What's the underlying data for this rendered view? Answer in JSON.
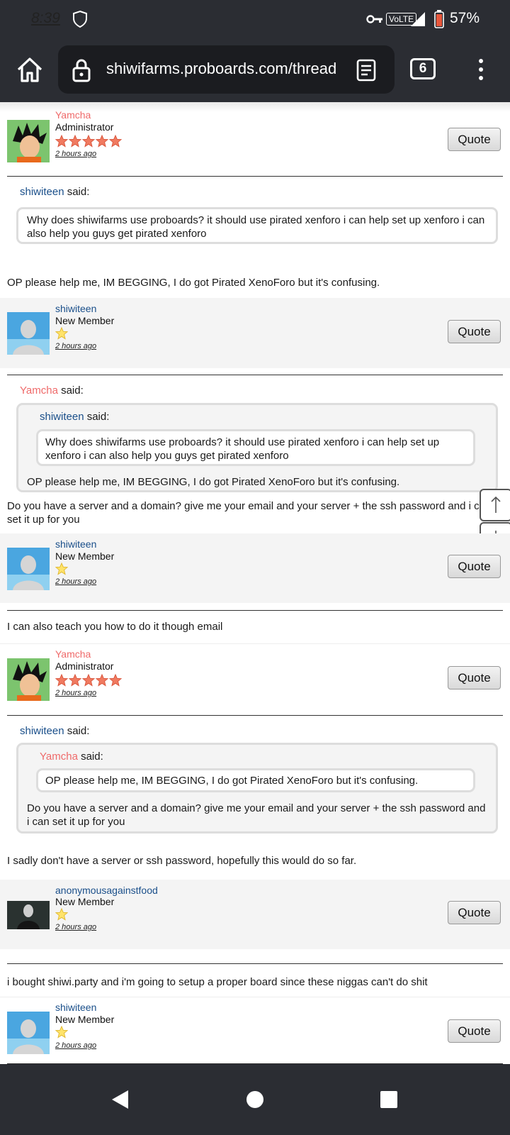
{
  "status_bar": {
    "time": "8:39",
    "volte": "VoLTE",
    "battery": "57%"
  },
  "browser": {
    "url": "shiwifarms.proboards.com/thread",
    "tab_count": "6"
  },
  "posts": [
    {
      "user": "Yamcha",
      "rank": "Administrator",
      "stars": 5,
      "time": "2 hours ago",
      "quote_btn": "Quote",
      "quoted_user": "shiwiteen",
      "quoted_text": "Why does shiwifarms use proboards? it should use pirated xenforo i can help set up xenforo i can also help you guys get pirated xenforo",
      "body": "OP please help me, IM BEGGING, I do got Pirated XenoForo but it's confusing."
    },
    {
      "user": "shiwiteen",
      "rank": "New Member",
      "stars": 1,
      "time": "2 hours ago",
      "quote_btn": "Quote",
      "quoted_user": "Yamcha",
      "nested_user": "shiwiteen",
      "nested_text": "Why does shiwifarms use proboards? it should use pirated xenforo i can help set up xenforo i can also help you guys get pirated xenforo",
      "quoted_text": "OP please help me, IM BEGGING, I do got Pirated XenoForo but it's confusing.",
      "body": "Do you have a server and a domain? give me your email and your server + the ssh password and i can set it up for you"
    },
    {
      "user": "shiwiteen",
      "rank": "New Member",
      "stars": 1,
      "time": "2 hours ago",
      "quote_btn": "Quote",
      "body": "I can also teach you how to do it though email"
    },
    {
      "user": "Yamcha",
      "rank": "Administrator",
      "stars": 5,
      "time": "2 hours ago",
      "quote_btn": "Quote",
      "quoted_user": "shiwiteen",
      "nested_user": "Yamcha",
      "nested_text": "OP please help me, IM BEGGING, I do got Pirated XenoForo but it's confusing.",
      "quoted_text": "Do you have a server and a domain? give me your email and your server + the ssh password and i can set it up for you",
      "body": "I sadly don't have a server or ssh password, hopefully this would do so far."
    },
    {
      "user": "anonymousagainstfood",
      "rank": "New Member",
      "stars": 1,
      "time": "2 hours ago",
      "quote_btn": "Quote",
      "body": "i bought shiwi.party and i'm going to setup a proper board since these niggas can't do shit"
    },
    {
      "user": "shiwiteen",
      "rank": "New Member",
      "stars": 1,
      "time": "2 hours ago",
      "quote_btn": "Quote"
    }
  ],
  "said_label": "said:",
  "colors": {
    "admin_name": "#ef6a6a",
    "member_name": "#1a4f8a",
    "chrome_bg": "#2b2d33"
  }
}
